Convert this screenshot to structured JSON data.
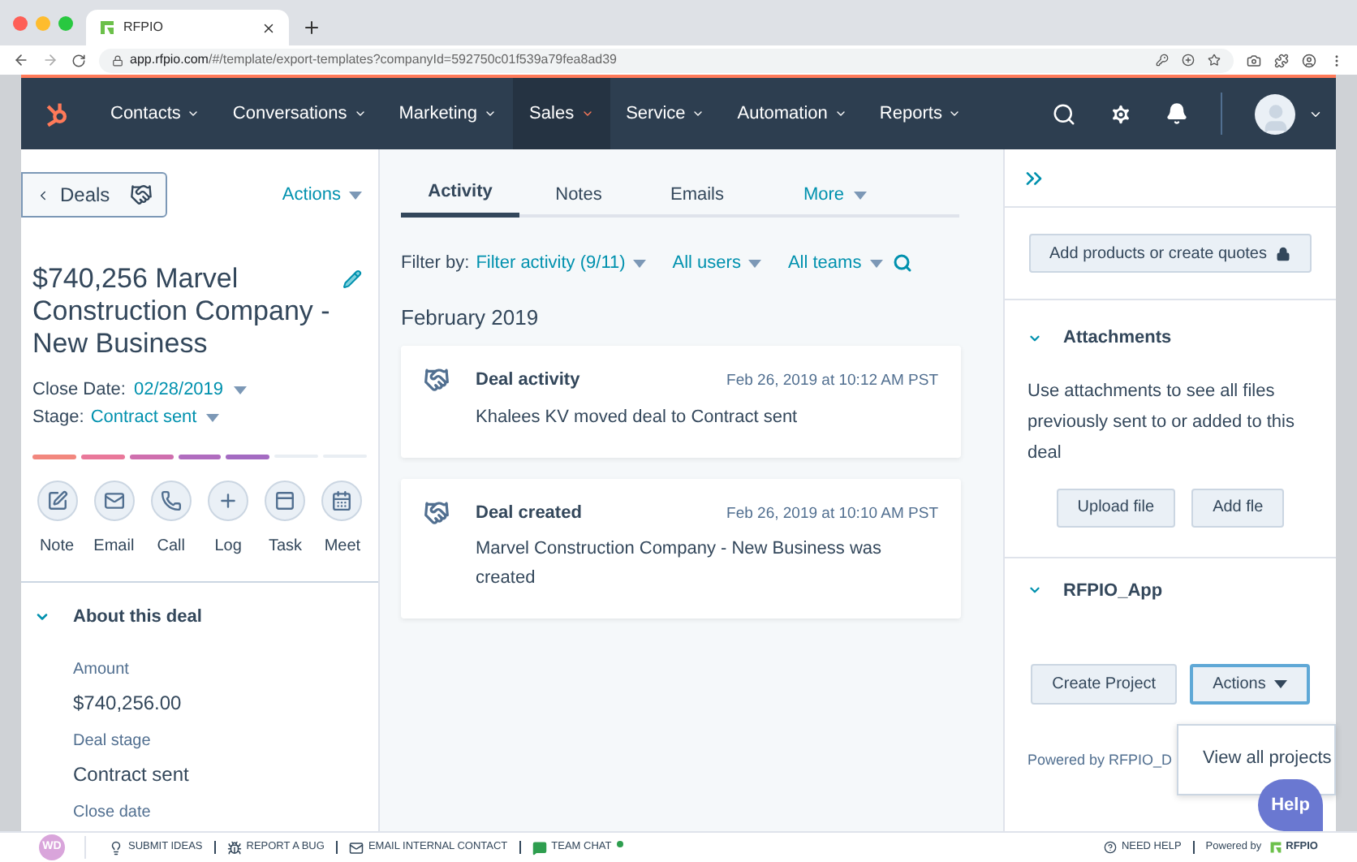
{
  "browser": {
    "tab_title": "RFPIO",
    "url_host": "app.rfpio.com",
    "url_path": "/#/template/export-templates?companyId=592750c01f539a79fea8ad39"
  },
  "nav": {
    "items": [
      {
        "label": "Contacts",
        "selected": false
      },
      {
        "label": "Conversations",
        "selected": false
      },
      {
        "label": "Marketing",
        "selected": false
      },
      {
        "label": "Sales",
        "selected": true
      },
      {
        "label": "Service",
        "selected": false
      },
      {
        "label": "Automation",
        "selected": false
      },
      {
        "label": "Reports",
        "selected": false
      }
    ]
  },
  "deal": {
    "back_label": "Deals",
    "actions_label": "Actions",
    "title": "$740,256 Marvel Construction Company - New Business",
    "close_date_label": "Close Date:",
    "close_date": "02/28/2019",
    "stage_label": "Stage:",
    "stage": "Contract sent",
    "stage_bar": [
      {
        "color": "#f2877e",
        "filled": true
      },
      {
        "color": "#e9789a",
        "filled": true
      },
      {
        "color": "#cf6fae",
        "filled": true
      },
      {
        "color": "#b06cbf",
        "filled": true
      },
      {
        "color": "#a46bc2",
        "filled": true
      },
      {
        "color": "#e9eef3",
        "filled": false
      },
      {
        "color": "#e9eef3",
        "filled": false
      }
    ],
    "quick_actions": [
      {
        "kind": "note",
        "label": "Note"
      },
      {
        "kind": "email",
        "label": "Email"
      },
      {
        "kind": "call",
        "label": "Call"
      },
      {
        "kind": "log",
        "label": "Log"
      },
      {
        "kind": "task",
        "label": "Task"
      },
      {
        "kind": "meet",
        "label": "Meet"
      }
    ],
    "about": {
      "title": "About this deal",
      "expanded": true,
      "fields": [
        {
          "label": "Amount",
          "value": "$740,256.00"
        },
        {
          "label": "Deal stage",
          "value": "Contract sent"
        },
        {
          "label": "Close date"
        }
      ]
    }
  },
  "activity": {
    "tabs": [
      {
        "label": "Activity",
        "selected": true
      },
      {
        "label": "Notes",
        "selected": false
      },
      {
        "label": "Emails",
        "selected": false
      },
      {
        "label": "More",
        "selected": false
      }
    ],
    "filter_label": "Filter by:",
    "filters": [
      "Filter activity (9/11)",
      "All users",
      "All teams"
    ],
    "month": "February 2019",
    "cards": [
      {
        "title": "Deal activity",
        "time": "Feb 26, 2019 at 10:12 AM PST",
        "body": "Khalees KV moved deal to Contract sent"
      },
      {
        "title": "Deal created",
        "time": "Feb 26, 2019 at 10:10 AM PST",
        "body": "Marvel Construction Company - New Business was created"
      }
    ]
  },
  "sidebar": {
    "quotes_button": "Add products or create quotes",
    "attachments": {
      "title": "Attachments",
      "expanded": true,
      "text": "Use attachments to see all files previously sent to or added to this deal",
      "buttons": [
        "Upload file",
        "Add fle"
      ]
    },
    "app": {
      "title": "RFPIO_App",
      "expanded": true,
      "create_button": "Create Project",
      "actions_button": "Actions",
      "menu_items": [
        "View all projects"
      ],
      "powered_by": "Powered by RFPIO_D"
    },
    "help_button": "Help"
  },
  "footer": {
    "avatar": "WD",
    "links": [
      {
        "kind": "ideas",
        "label": "SUBMIT IDEAS"
      },
      {
        "kind": "bug",
        "label": "REPORT A BUG"
      },
      {
        "kind": "email",
        "label": "EMAIL INTERNAL CONTACT"
      },
      {
        "kind": "chat",
        "label": "TEAM CHAT"
      }
    ],
    "need_help": "NEED HELP",
    "powered_by": "Powered by",
    "brand": "RFPIO"
  }
}
